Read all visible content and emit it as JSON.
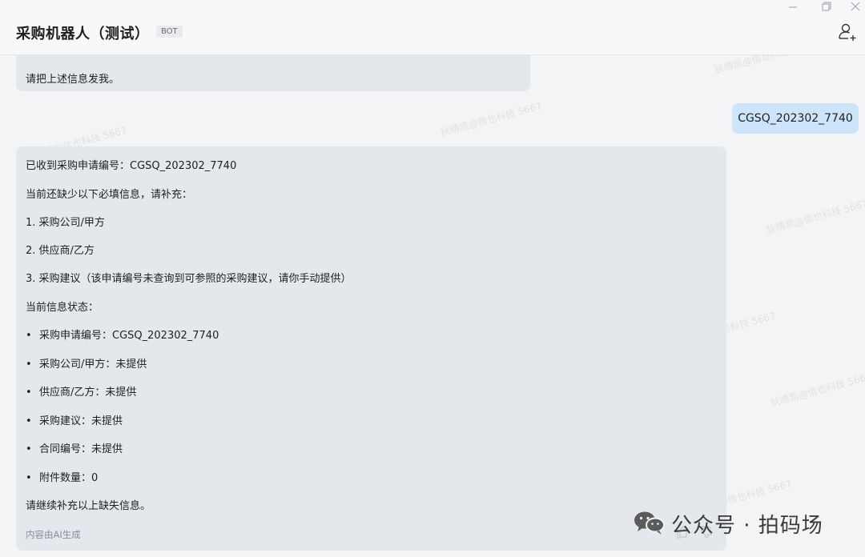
{
  "header": {
    "title": "采购机器人（测试）",
    "badge": "BOT"
  },
  "messages": {
    "previous_bot_tail": "请把上述信息发我。",
    "user_message": "CGSQ_202302_7740",
    "bot_reply": {
      "line1": "已收到采购申请编号：CGSQ_202302_7740",
      "line2": "当前还缺少以下必填信息，请补充：",
      "missing": [
        "1. 采购公司/甲方",
        "2. 供应商/乙方",
        "3. 采购建议（该申请编号未查询到可参照的采购建议，请你手动提供）"
      ],
      "status_header": "当前信息状态：",
      "bullet_char": "•",
      "status_items": [
        "采购申请编号：CGSQ_202302_7740",
        "采购公司/甲方：未提供",
        "供应商/乙方：未提供",
        "采购建议：未提供",
        "合同编号：未提供",
        "附件数量：0"
      ],
      "closing": "请继续补充以上缺失信息。",
      "ai_note": "内容由AI生成"
    }
  },
  "watermark": {
    "text": "狄晴凯@信也科技 5667"
  },
  "footer_badge": {
    "text": "公众号 · 拍码场"
  },
  "colors": {
    "bot_bubble": "#e4e7ec",
    "user_bubble": "#cde5fa",
    "background": "#f3f4f6"
  },
  "icons": [
    "minimize-icon",
    "restore-icon",
    "close-icon",
    "add-member-icon",
    "wechat-icon"
  ]
}
